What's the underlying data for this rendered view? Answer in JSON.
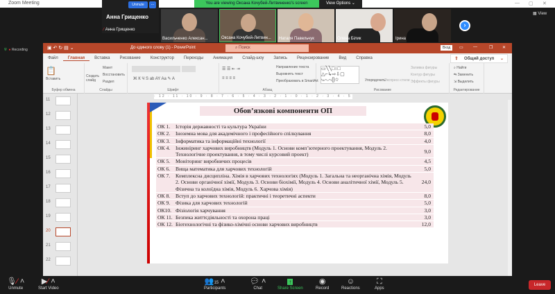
{
  "zoom": {
    "window_title": "Zoom Meeting",
    "banner": "You are viewing Оксана Кочубей-Литвиненко's screen",
    "view_options": "View Options",
    "view_label": "View",
    "recording": "Recording",
    "self_name": "Анна Грищенко",
    "unmute_mini": "Unmute",
    "more_mini": "...",
    "participants": [
      "Анна Грищенко",
      "Васильченко Алексан...",
      "Оксана Кочубей-Литвин...",
      "Наталя Павельчук",
      "Олена Білик",
      "Ірина"
    ]
  },
  "ppt": {
    "title": "До єдиного слову (1) - PowerPoint",
    "search": "Поиск",
    "signin": "Вход",
    "tabs": [
      "Файл",
      "Главная",
      "Вставка",
      "Рисование",
      "Конструктор",
      "Переходы",
      "Анимация",
      "Слайд-шоу",
      "Запись",
      "Рецензирование",
      "Вид",
      "Справка"
    ],
    "share": "Общий доступ",
    "ribbon": {
      "paste": "Вставить",
      "clipboard": "Буфер обмена",
      "new_slide": "Создать слайд",
      "layout": "Макет",
      "reset": "Восстановить",
      "section": "Раздел",
      "slides": "Слайды",
      "font": "Шрифт",
      "paragraph": "Абзац",
      "text_dir": "Направление текста",
      "align_text": "Выровнять текст",
      "smartart": "Преобразовать в SmartArt",
      "arrange": "Упорядочить",
      "quick_styles": "Экспресс-стили",
      "fill": "Заливка фигуры",
      "outline": "Контур фигуры",
      "effects": "Эффекты фигуры",
      "drawing": "Рисование",
      "find": "Найти",
      "replace": "Заменить",
      "select": "Выделить",
      "editing": "Редактирование"
    },
    "ruler": "· 12 · 11 · 10 · 9 · 8 · 7 · 6 · 5 · 4 · 3 · 2 · 1 · 0 · 1 · 2 · 3 · 4 · 5 · 6 · 7 · 8 · 9 · 10 · 11 · 12 ·",
    "thumbnails": [
      "11",
      "12",
      "13",
      "14",
      "15",
      "16",
      "17",
      "18",
      "19",
      "20",
      "21",
      "22"
    ],
    "current_slide": "20"
  },
  "slide": {
    "title": "Обов’язкові компоненти ОП",
    "rows": [
      {
        "code": "ОК 1.",
        "name": "Історія державності та культура України",
        "credits": "5,0"
      },
      {
        "code": "ОК 2.",
        "name": "Іноземна мова для академічного і професійного спілкування",
        "credits": "8,0"
      },
      {
        "code": "ОК 3.",
        "name": "Інформатика та інформаційні технології",
        "credits": "4,0"
      },
      {
        "code": "ОК 4.",
        "name": "Інжиніринг харчових виробництв (Модуль 1. Основи комп’ютерного проектування, Модуль 2. Технологічне проектування, в тому числі курсовий проект)",
        "credits": "9,0"
      },
      {
        "code": "ОК 5.",
        "name": "Моніторинг виробничих процесів",
        "credits": "4,5"
      },
      {
        "code": "ОК 6.",
        "name": "Вища математика для харчових технологій",
        "credits": "5,0"
      },
      {
        "code": "ОК 7.",
        "name": "Комплексна дисципліна. Хімія в харчових технологіях (Модуль 1. Загальна та неорганічна хімія, Модуль 2. Основи органічної хімії, Модуль 3. Основи біохімії, Модуль 4. Основи аналітичної хімії, Модуль 5. Фізична та колоїдна хімія, Модуль 6. Харчова хімія)",
        "credits": "24,0"
      },
      {
        "code": "ОК 8.",
        "name": "Вступ до харчових технологій: практичні і теоретичні аспекти",
        "credits": "8,0"
      },
      {
        "code": "ОК 9.",
        "name": "Фізика для харчових технологій",
        "credits": "5,0"
      },
      {
        "code": "ОК10.",
        "name": "Фізіологія харчування",
        "credits": "3,0"
      },
      {
        "code": "ОК 11.",
        "name": "Безпека життєдіяльності та охорона праці",
        "credits": "3,0"
      },
      {
        "code": "ОК 12.",
        "name": "Біотехнологічні та фізико-хімічні основи харчових виробництв",
        "credits": "12,0"
      }
    ]
  },
  "toolbar": {
    "unmute": "Unmute",
    "start_video": "Start Video",
    "participants": "Participants",
    "participants_count": "15",
    "chat": "Chat",
    "share": "Share Screen",
    "record": "Record",
    "reactions": "Reactions",
    "apps": "Apps",
    "leave": "Leave"
  }
}
